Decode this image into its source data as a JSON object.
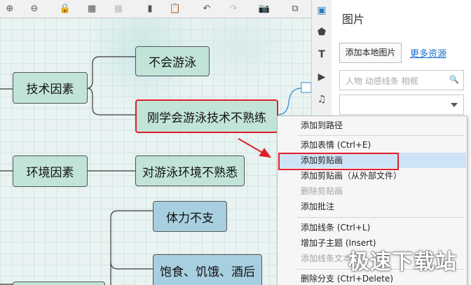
{
  "toolbar": {
    "buttons": [
      {
        "name": "zoom-in-icon",
        "glyph": "⊕",
        "enabled": true
      },
      {
        "name": "zoom-out-icon",
        "glyph": "⊖",
        "enabled": true
      },
      {
        "name": "lock-icon",
        "glyph": "🔒",
        "enabled": true
      },
      {
        "name": "grid-icon",
        "glyph": "▦",
        "enabled": true
      },
      {
        "name": "grid-settings-icon",
        "glyph": "▦",
        "enabled": false
      },
      {
        "name": "copy-icon",
        "glyph": "▮",
        "enabled": true
      },
      {
        "name": "paste-icon",
        "glyph": "📋",
        "enabled": true
      },
      {
        "name": "undo-icon",
        "glyph": "↶",
        "enabled": true
      },
      {
        "name": "redo-icon",
        "glyph": "↷",
        "enabled": false
      },
      {
        "name": "camera-icon",
        "glyph": "📷",
        "enabled": true
      },
      {
        "name": "window-icon",
        "glyph": "⧉",
        "enabled": true
      }
    ]
  },
  "mindmap": {
    "node_tech": "技术因素",
    "node_cannot_swim": "不会游泳",
    "node_just_learned": "刚学会游泳技术不熟练",
    "node_env": "环境因素",
    "node_unfamiliar": "对游泳环境不熟悉",
    "node_stamina": "体力不支",
    "node_hunger": "饱食、饥饿、酒后"
  },
  "sidebar_icons": [
    "image-icon",
    "shape-icon",
    "text-icon",
    "video-icon",
    "music-icon"
  ],
  "panel": {
    "title": "图片",
    "add_local_label": "添加本地图片",
    "more_resources_label": "更多资源",
    "search_placeholder": "人物 动感线条 相框"
  },
  "context_menu": {
    "items": [
      {
        "label": "添加到路径",
        "disabled": false,
        "highlighted": false
      },
      {
        "label": "添加表情 (Ctrl+E)",
        "disabled": false,
        "highlighted": false
      },
      {
        "label": "添加剪贴画",
        "disabled": false,
        "highlighted": true
      },
      {
        "label": "添加剪贴画（从外部文件）",
        "disabled": false,
        "highlighted": false
      },
      {
        "label": "删除剪贴画",
        "disabled": true,
        "highlighted": false
      },
      {
        "label": "添加批注",
        "disabled": false,
        "highlighted": false
      },
      {
        "label": "添加线条 (Ctrl+L)",
        "disabled": false,
        "highlighted": false
      },
      {
        "label": "增加子主题 (Insert)",
        "disabled": false,
        "highlighted": false
      },
      {
        "label": "添加线条文本",
        "disabled": true,
        "highlighted": false
      },
      {
        "label": "删除分支 (Ctrl+Delete)",
        "disabled": false,
        "highlighted": false
      }
    ]
  },
  "watermark": "极速下载站",
  "colors": {
    "selection_outline": "#e0202a",
    "node_green": "#c2e4d8",
    "node_blue": "#a8cfe0",
    "menu_highlight": "#cfe3f6",
    "link": "#1a6fc9"
  }
}
